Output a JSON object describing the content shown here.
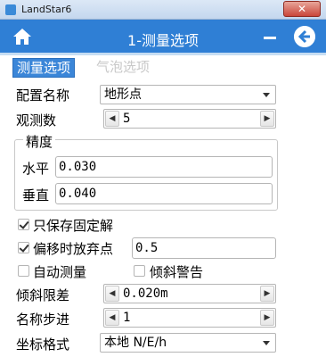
{
  "window": {
    "app_name": "LandStar6",
    "close_glyph": "✕"
  },
  "header": {
    "title": "1-测量选项",
    "home_icon": "home-icon",
    "minimize_icon": "minus-icon",
    "back_icon": "back-arrow-icon",
    "accent_color": "#2f7fd5"
  },
  "tabs": [
    {
      "label": "测量选项",
      "active": true
    },
    {
      "label": "气泡选项",
      "active": false
    }
  ],
  "form": {
    "config_name": {
      "label": "配置名称",
      "value": "地形点"
    },
    "obs_count": {
      "label": "观测数",
      "value": "5"
    },
    "precision": {
      "title": "精度",
      "horizontal": {
        "label": "水平",
        "value": "0.030"
      },
      "vertical": {
        "label": "垂直",
        "value": "0.040"
      }
    },
    "save_fixed_only": {
      "label": "只保存固定解",
      "checked": true
    },
    "offset_discard": {
      "label": "偏移时放弃点",
      "checked": true,
      "value": "0.5"
    },
    "auto_measure": {
      "label": "自动测量",
      "checked": false
    },
    "tilt_warning": {
      "label": "倾斜警告",
      "checked": false
    },
    "tilt_limit": {
      "label": "倾斜限差",
      "value": "0.020m"
    },
    "name_step": {
      "label": "名称步进",
      "value": "1"
    },
    "coord_format": {
      "label": "坐标格式",
      "value": "本地 N/E/h"
    }
  },
  "spin_glyphs": {
    "left": "◀",
    "right": "▶"
  }
}
